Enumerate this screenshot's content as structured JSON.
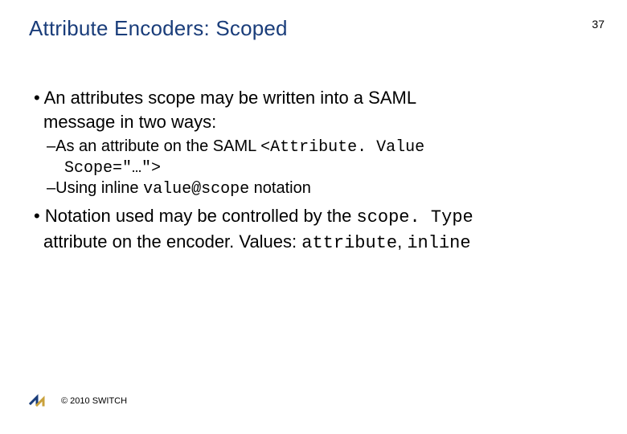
{
  "header": {
    "title": "Attribute Encoders: Scoped",
    "page_number": "37"
  },
  "body": {
    "b1_lead": "• An attributes scope may be written into a SAML",
    "b1_cont": "message in two ways:",
    "s1_lead": "–As an attribute on the SAML ",
    "s1_code1": "<Attribute. Value",
    "s1_code2": "Scope=\"…\">",
    "s2_lead": "–Using inline ",
    "s2_code": "value@scope",
    "s2_tail": " notation",
    "b2_lead": "• Notation used may be controlled by the ",
    "b2_code1": "scope. Type",
    "b2_mid": "attribute on the encoder.  Values: ",
    "b2_code2": "attribute",
    "b2_comma": ", ",
    "b2_code3": "inline"
  },
  "footer": {
    "copyright": "© 2010 SWITCH"
  }
}
